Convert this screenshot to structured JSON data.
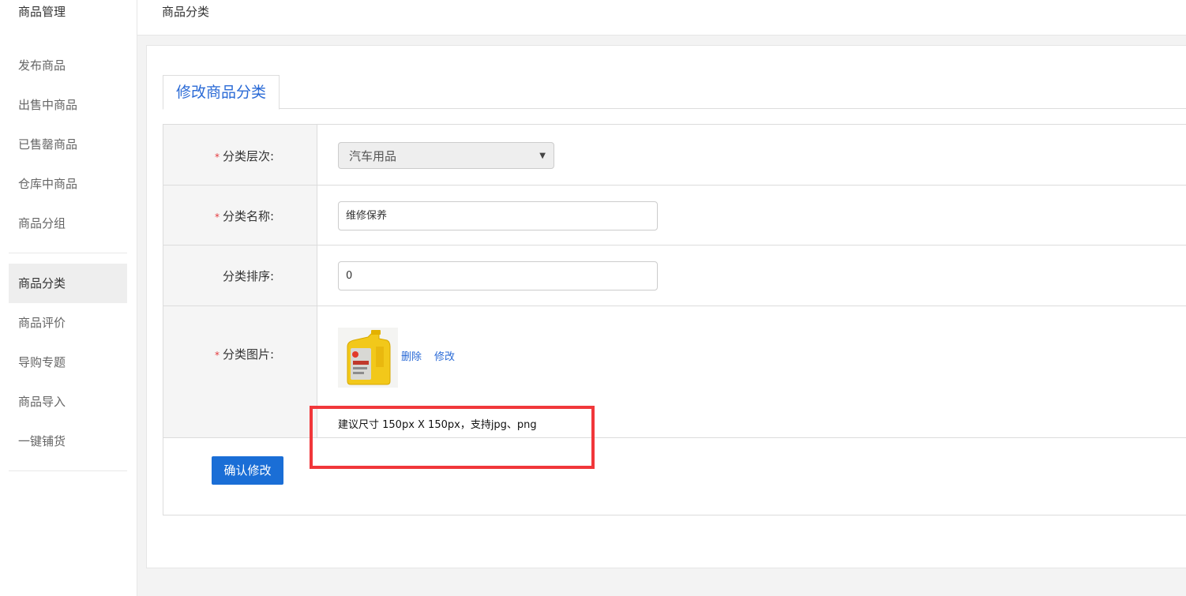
{
  "sidebar": {
    "title": "商品管理",
    "items": [
      {
        "label": "发布商品"
      },
      {
        "label": "出售中商品"
      },
      {
        "label": "已售罄商品"
      },
      {
        "label": "仓库中商品"
      },
      {
        "label": "商品分组"
      },
      {
        "label": "商品分类",
        "active": true
      },
      {
        "label": "商品评价"
      },
      {
        "label": "导购专题"
      },
      {
        "label": "商品导入"
      },
      {
        "label": "一键铺货"
      }
    ]
  },
  "header": {
    "breadcrumb": "商品分类"
  },
  "main": {
    "tab_label": "修改商品分类",
    "form": {
      "level": {
        "label": "分类层次:",
        "required_mark": "*",
        "value": "汽车用品"
      },
      "name": {
        "label": "分类名称:",
        "required_mark": "*",
        "value": "维修保养"
      },
      "sort": {
        "label": "分类排序:",
        "value": "0"
      },
      "image": {
        "label": "分类图片:",
        "required_mark": "*",
        "delete_link": "删除",
        "edit_link": "修改",
        "hint": "建议尺寸 150px X 150px，支持jpg、png"
      }
    },
    "submit_label": "确认修改"
  },
  "colors": {
    "accent": "#1a6ed6",
    "link": "#2a6ad6",
    "required": "#e4393c",
    "highlight_box": "#f1373a"
  }
}
